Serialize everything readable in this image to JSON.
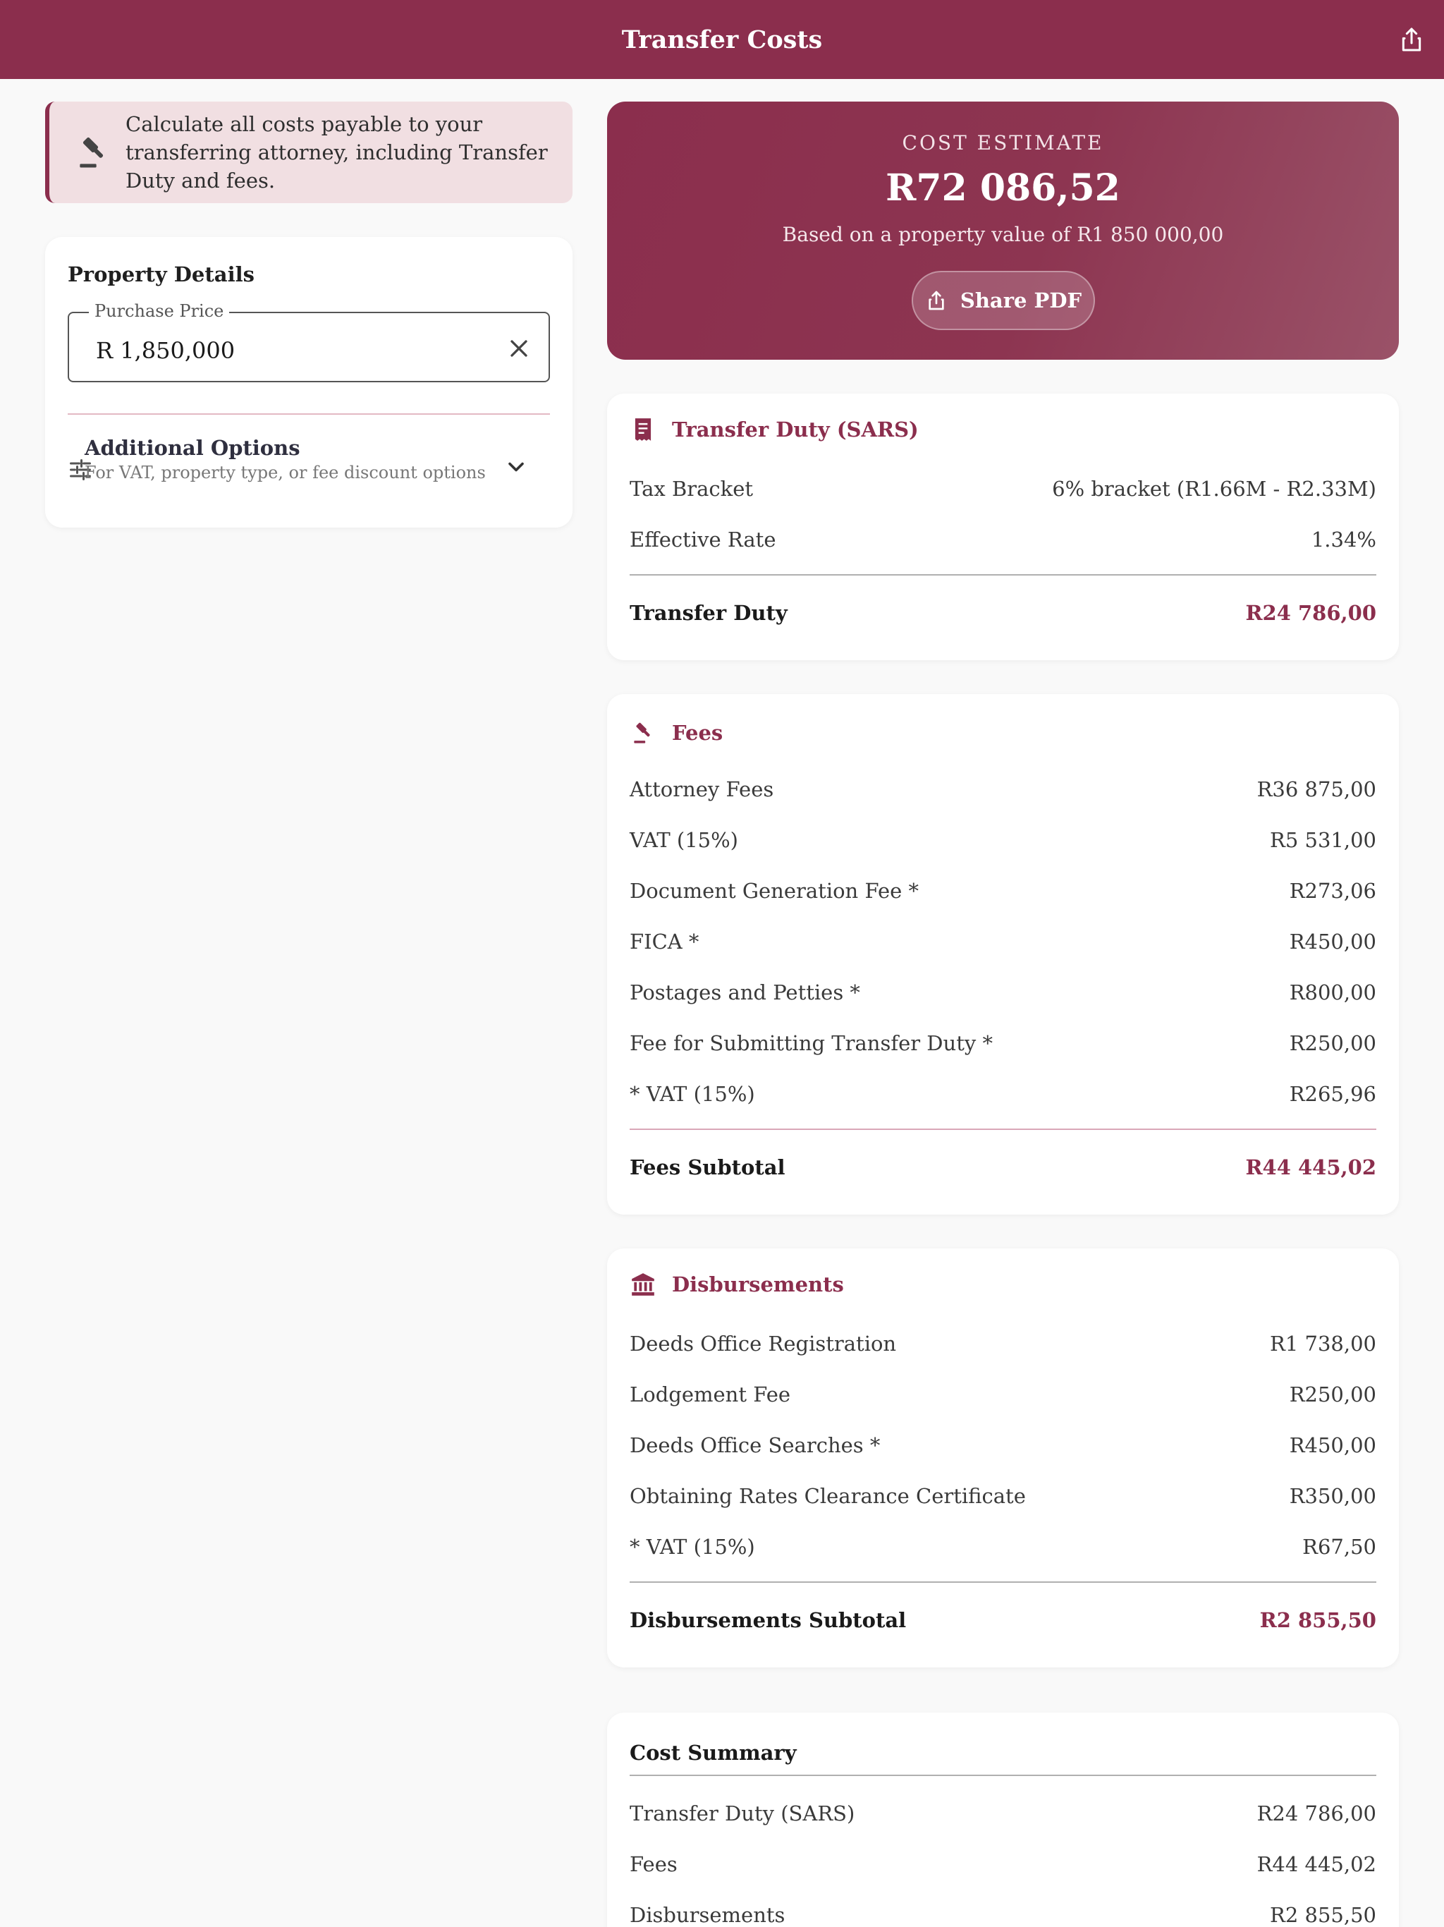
{
  "app_bar": {
    "title": "Transfer Costs"
  },
  "info": {
    "text": "Calculate all costs payable to your transferring attorney, including Transfer Duty and fees."
  },
  "property": {
    "heading": "Property Details",
    "price_label": "Purchase Price",
    "price_value": "R 1,850,000",
    "options_title": "Additional Options",
    "options_sub": "For VAT, property type, or fee discount options"
  },
  "estimate": {
    "kicker": "COST ESTIMATE",
    "amount": "R72 086,52",
    "basis": "Based on a property value of R1 850 000,00",
    "share_label": "Share PDF"
  },
  "duty": {
    "title": "Transfer Duty (SARS)",
    "rows": [
      {
        "label": "Tax Bracket",
        "value": "6% bracket (R1.66M - R2.33M)"
      },
      {
        "label": "Effective Rate",
        "value": "1.34%"
      }
    ],
    "total_label": "Transfer Duty",
    "total_value": "R24 786,00"
  },
  "fees": {
    "title": "Fees",
    "rows": [
      {
        "label": "Attorney Fees",
        "value": "R36 875,00"
      },
      {
        "label": "VAT (15%)",
        "value": "R5 531,00"
      },
      {
        "label": "Document Generation Fee *",
        "value": "R273,06"
      },
      {
        "label": "FICA *",
        "value": "R450,00"
      },
      {
        "label": "Postages and Petties *",
        "value": "R800,00"
      },
      {
        "label": "Fee for Submitting Transfer Duty *",
        "value": "R250,00"
      },
      {
        "label": "* VAT (15%)",
        "value": "R265,96"
      }
    ],
    "total_label": "Fees Subtotal",
    "total_value": "R44 445,02"
  },
  "disb": {
    "title": "Disbursements",
    "rows": [
      {
        "label": "Deeds Office Registration",
        "value": "R1 738,00"
      },
      {
        "label": "Lodgement Fee",
        "value": "R250,00"
      },
      {
        "label": "Deeds Office Searches *",
        "value": "R450,00"
      },
      {
        "label": "Obtaining Rates Clearance Certificate",
        "value": "R350,00"
      },
      {
        "label": "* VAT (15%)",
        "value": "R67,50"
      }
    ],
    "total_label": "Disbursements Subtotal",
    "total_value": "R2 855,50"
  },
  "summary": {
    "title": "Cost Summary",
    "rows": [
      {
        "label": "Transfer Duty (SARS)",
        "value": "R24 786,00"
      },
      {
        "label": "Fees",
        "value": "R44 445,02"
      },
      {
        "label": "Disbursements",
        "value": "R2 855,50"
      }
    ]
  },
  "colors": {
    "brand": "#8b2e4d",
    "banner_bg": "#f1dfe2",
    "page_bg": "#f9f9f9"
  }
}
